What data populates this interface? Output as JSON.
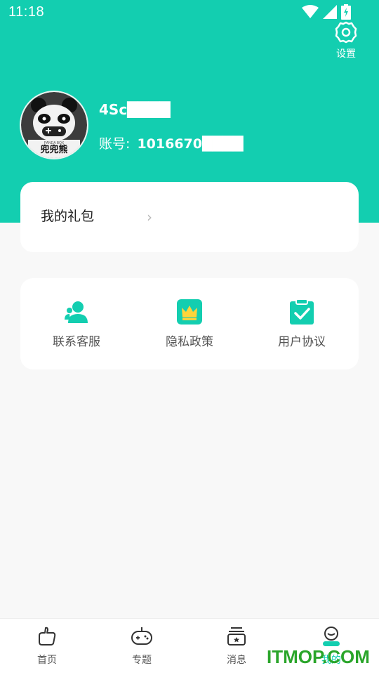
{
  "status_bar": {
    "time": "11:18"
  },
  "header": {
    "settings_label": "设置",
    "username": "4Sc████",
    "account_label": "账号:",
    "account_value": "1016670████"
  },
  "avatar": {
    "brand_small": "PANDA BOX",
    "brand_big": "兜兜熊"
  },
  "gift_card": {
    "label": "我的礼包"
  },
  "menu": {
    "items": [
      {
        "label": "联系客服",
        "icon": "customer-service-icon"
      },
      {
        "label": "隐私政策",
        "icon": "crown-icon"
      },
      {
        "label": "用户协议",
        "icon": "clipboard-check-icon"
      }
    ]
  },
  "bottom_nav": {
    "items": [
      {
        "label": "首页",
        "icon": "home-icon"
      },
      {
        "label": "专题",
        "icon": "gamepad-icon"
      },
      {
        "label": "消息",
        "icon": "message-box-icon"
      },
      {
        "label": "我的",
        "icon": "profile-icon",
        "active": true
      }
    ]
  },
  "watermark": "ITMOP.COM",
  "colors": {
    "accent": "#13ceb0",
    "background": "#f8f8f8"
  }
}
